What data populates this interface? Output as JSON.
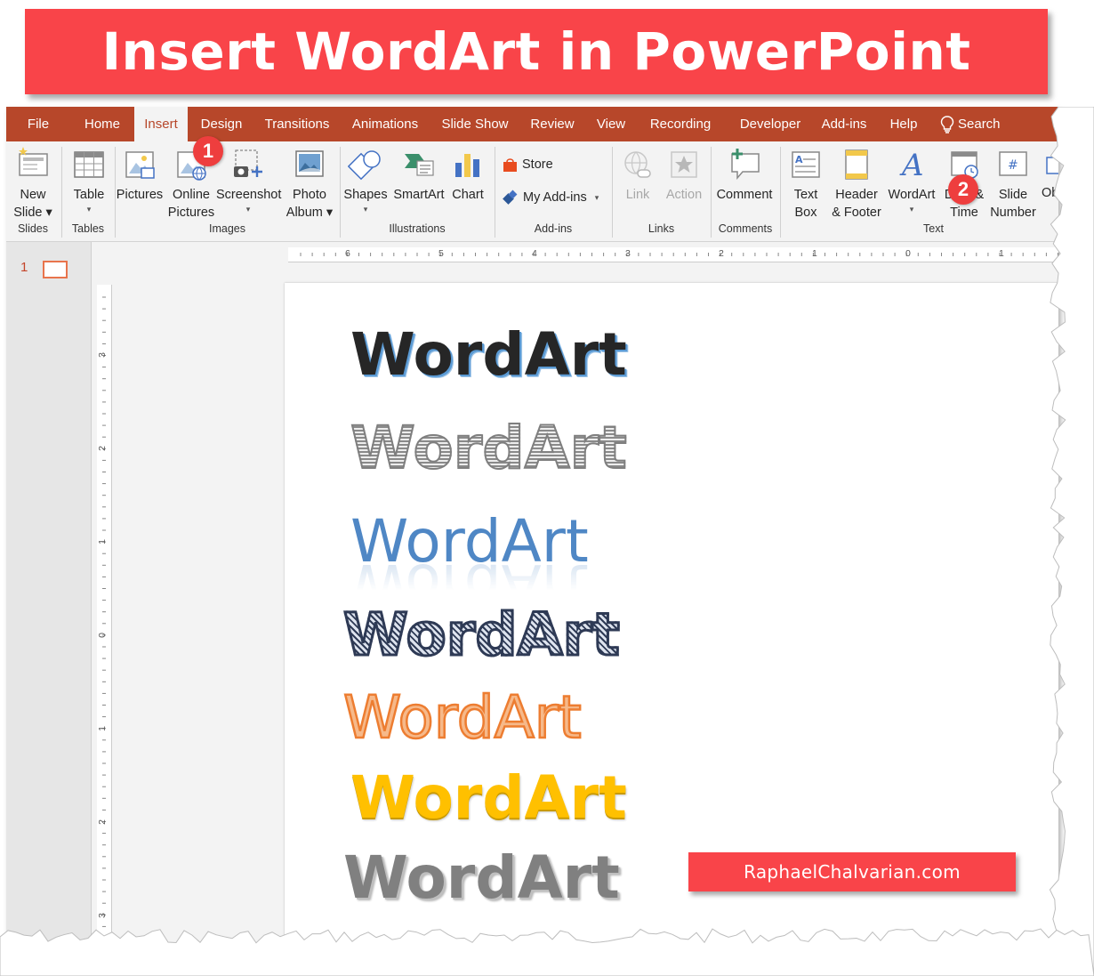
{
  "banner": {
    "title": "Insert WordArt in PowerPoint"
  },
  "tabs": [
    {
      "label": "File"
    },
    {
      "label": "Home"
    },
    {
      "label": "Insert",
      "active": true
    },
    {
      "label": "Design"
    },
    {
      "label": "Transitions"
    },
    {
      "label": "Animations"
    },
    {
      "label": "Slide Show"
    },
    {
      "label": "Review"
    },
    {
      "label": "View"
    },
    {
      "label": "Recording"
    },
    {
      "label": "Developer"
    },
    {
      "label": "Add-ins"
    },
    {
      "label": "Help"
    },
    {
      "label": "Search"
    }
  ],
  "ribbon": {
    "new_slide": [
      "New",
      "Slide"
    ],
    "table": "Table",
    "pictures": "Pictures",
    "online_pictures": [
      "Online",
      "Pictures"
    ],
    "screenshot": "Screenshot",
    "photo_album": [
      "Photo",
      "Album"
    ],
    "shapes": "Shapes",
    "smartart": "SmartArt",
    "chart": "Chart",
    "store": "Store",
    "my_addins": "My Add-ins",
    "link": "Link",
    "action": "Action",
    "comment": "Comment",
    "text_box": [
      "Text",
      "Box"
    ],
    "header_footer": [
      "Header",
      "& Footer"
    ],
    "wordart": "WordArt",
    "date_time": [
      "Date &",
      "Time"
    ],
    "slide_number": [
      "Slide",
      "Number"
    ],
    "object": "Ob",
    "groups": {
      "slides": "Slides",
      "tables": "Tables",
      "images": "Images",
      "illustrations": "Illustrations",
      "addins": "Add-ins",
      "links": "Links",
      "comments": "Comments",
      "text": "Text"
    }
  },
  "callouts": {
    "one": "1",
    "two": "2"
  },
  "thumbnail": {
    "slide_number": "1"
  },
  "ruler": {
    "horizontal": [
      "6",
      "5",
      "4",
      "3",
      "2",
      "1",
      "0",
      "1"
    ],
    "vertical": [
      "3",
      "2",
      "1",
      "0",
      "1",
      "2",
      "3"
    ]
  },
  "slide": {
    "wordart": [
      "WordArt",
      "WordArt",
      "WordArt",
      "WordArt",
      "WordArt",
      "WordArt",
      "WordArt"
    ],
    "site": "RaphaelChalvarian.com"
  },
  "colors": {
    "banner": "#f94449",
    "tabbar": "#b7472a",
    "ribbon": "#f3f3f3",
    "accent_orange": "#ed7d31",
    "accent_blue": "#5b9bd5",
    "accent_gold": "#ffc000"
  }
}
